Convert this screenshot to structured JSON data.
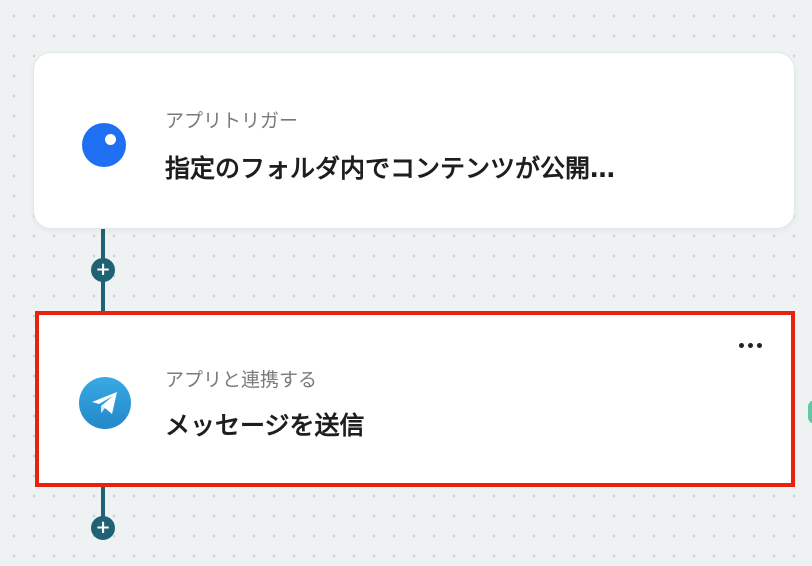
{
  "flow": {
    "trigger_step": {
      "subtitle": "アプリトリガー",
      "title": "指定のフォルダ内でコンテンツが公開…",
      "icon": "app-trigger-icon",
      "icon_color": "#1f6ff2"
    },
    "action_step": {
      "subtitle": "アプリと連携する",
      "title": "メッセージを送信",
      "icon": "telegram-icon",
      "highlight_color": "#e8220c"
    },
    "add_step_symbol": "+",
    "connector_color": "#1f6273"
  }
}
